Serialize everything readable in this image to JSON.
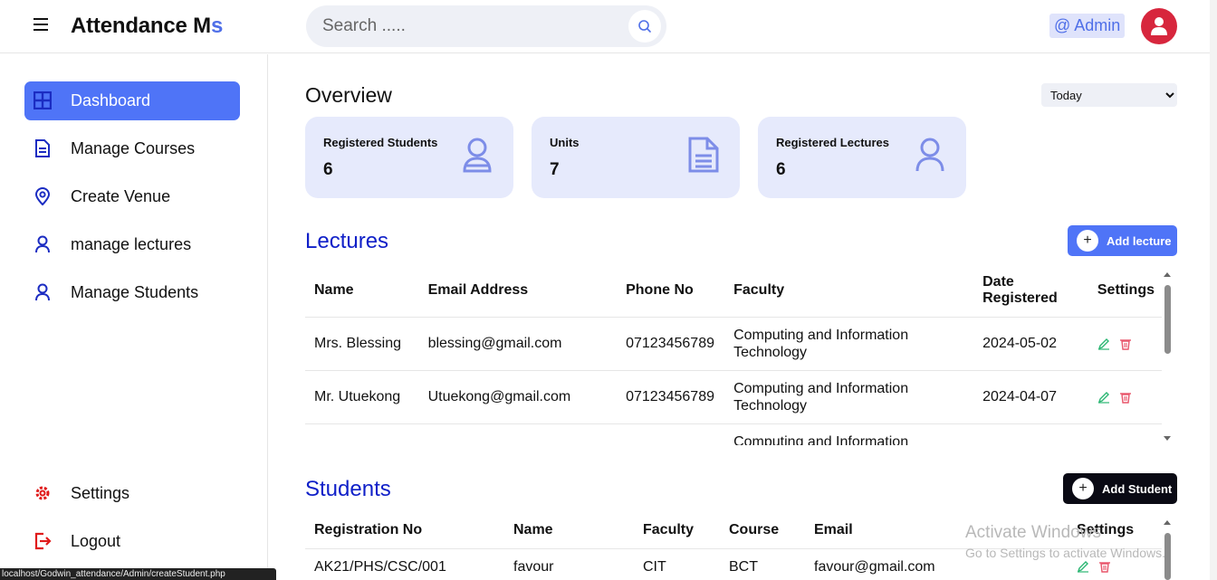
{
  "header": {
    "app_title_main": "Attendance M",
    "app_title_accent": "s",
    "search_placeholder": "Search .....",
    "admin_label": "@ Admin"
  },
  "sidebar": {
    "items": [
      {
        "label": "Dashboard",
        "icon": "grid-icon",
        "active": true
      },
      {
        "label": "Manage Courses",
        "icon": "document-icon"
      },
      {
        "label": "Create Venue",
        "icon": "location-pin-icon"
      },
      {
        "label": "manage lectures",
        "icon": "user-icon"
      },
      {
        "label": "Manage Students",
        "icon": "user-icon"
      }
    ],
    "bottom_items": [
      {
        "label": "Settings",
        "icon": "gear-icon"
      },
      {
        "label": "Logout",
        "icon": "logout-icon"
      }
    ]
  },
  "status_bar_url": "localhost/Godwin_attendance/Admin/createStudent.php",
  "overview": {
    "title": "Overview",
    "period_options": [
      "Today"
    ],
    "period_selected": "Today",
    "cards": [
      {
        "label": "Registered Students",
        "value": "6",
        "icon": "user-badge-icon"
      },
      {
        "label": "Units",
        "value": "7",
        "icon": "document-icon"
      },
      {
        "label": "Registered Lectures",
        "value": "6",
        "icon": "user-icon"
      }
    ]
  },
  "lectures": {
    "title": "Lectures",
    "add_button": "Add lecture",
    "columns": [
      "Name",
      "Email Address",
      "Phone No",
      "Faculty",
      "Date Registered",
      "Settings"
    ],
    "rows": [
      {
        "name": "Mrs. Blessing",
        "email": "blessing@gmail.com",
        "phone": "07123456789",
        "faculty": "Computing and Information Technology",
        "date": "2024-05-02"
      },
      {
        "name": "Mr. Utuekong",
        "email": "Utuekong@gmail.com",
        "phone": "07123456789",
        "faculty": "Computing and Information Technology",
        "date": "2024-04-07"
      },
      {
        "name": "",
        "email": "",
        "phone": "",
        "faculty": "Computing and Information",
        "date": ""
      }
    ]
  },
  "students": {
    "title": "Students",
    "add_button": "Add Student",
    "columns": [
      "Registration No",
      "Name",
      "Faculty",
      "Course",
      "Email",
      "Settings"
    ],
    "rows": [
      {
        "reg": "AK21/PHS/CSC/001",
        "name": "favour",
        "faculty": "CIT",
        "course": "BCT",
        "email": "favour@gmail.com"
      }
    ]
  },
  "watermark": {
    "line1": "Activate Windows",
    "line2": "Go to Settings to activate Windows."
  },
  "colors": {
    "accent": "#4f74f7",
    "section_title": "#1020c8",
    "card_bg": "#e6eafc",
    "avatar_bg": "#d7263d",
    "edit_icon": "#2bb673",
    "delete_icon": "#e8556a"
  }
}
